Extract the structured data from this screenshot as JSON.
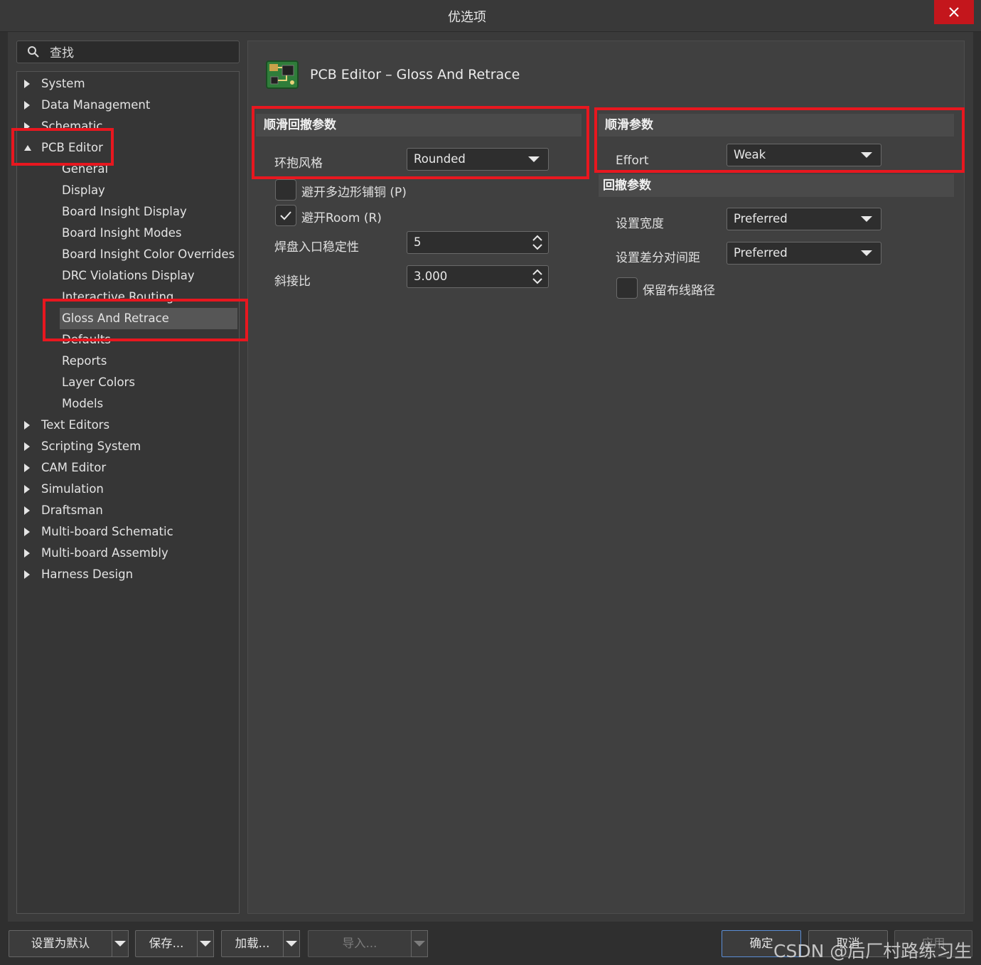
{
  "window": {
    "title": "优选项",
    "close_icon": "close-icon"
  },
  "search": {
    "placeholder": "查找"
  },
  "tree": {
    "items": [
      {
        "label": "System",
        "level": 1,
        "expanded": false
      },
      {
        "label": "Data Management",
        "level": 1,
        "expanded": false
      },
      {
        "label": "Schematic",
        "level": 1,
        "expanded": false
      },
      {
        "label": "PCB Editor",
        "level": 1,
        "expanded": true
      },
      {
        "label": "General",
        "level": 2
      },
      {
        "label": "Display",
        "level": 2
      },
      {
        "label": "Board Insight Display",
        "level": 2
      },
      {
        "label": "Board Insight Modes",
        "level": 2
      },
      {
        "label": "Board Insight Color Overrides",
        "level": 2
      },
      {
        "label": "DRC Violations Display",
        "level": 2
      },
      {
        "label": "Interactive Routing",
        "level": 2
      },
      {
        "label": "Gloss And Retrace",
        "level": 2,
        "selected": true
      },
      {
        "label": "Defaults",
        "level": 2
      },
      {
        "label": "Reports",
        "level": 2
      },
      {
        "label": "Layer Colors",
        "level": 2
      },
      {
        "label": "Models",
        "level": 2
      },
      {
        "label": "Text Editors",
        "level": 1,
        "expanded": false
      },
      {
        "label": "Scripting System",
        "level": 1,
        "expanded": false
      },
      {
        "label": "CAM Editor",
        "level": 1,
        "expanded": false
      },
      {
        "label": "Simulation",
        "level": 1,
        "expanded": false
      },
      {
        "label": "Draftsman",
        "level": 1,
        "expanded": false
      },
      {
        "label": "Multi-board Schematic",
        "level": 1,
        "expanded": false
      },
      {
        "label": "Multi-board Assembly",
        "level": 1,
        "expanded": false
      },
      {
        "label": "Harness Design",
        "level": 1,
        "expanded": false
      }
    ]
  },
  "page": {
    "title": "PCB Editor – Gloss And Retrace",
    "icon": "pcb-board-icon"
  },
  "gloss_retrace_params": {
    "header": "顺滑回撤参数",
    "hug_style_label": "环抱风格",
    "hug_style_value": "Rounded",
    "avoid_polygon_label": "避开多边形铺铜 (P)",
    "avoid_polygon_checked": false,
    "avoid_room_label": "避开Room (R)",
    "avoid_room_checked": true,
    "pad_entry_label": "焊盘入口稳定性",
    "pad_entry_value": "5",
    "miter_ratio_label": "斜接比",
    "miter_ratio_value": "3.000"
  },
  "gloss_params": {
    "header": "顺滑参数",
    "effort_label": "Effort",
    "effort_value": "Weak"
  },
  "retrace_params": {
    "header": "回撤参数",
    "width_label": "设置宽度",
    "width_value": "Preferred",
    "diff_gap_label": "设置差分对间距",
    "diff_gap_value": "Preferred",
    "keep_path_label": "保留布线路径",
    "keep_path_checked": false
  },
  "footer": {
    "set_default": "设置为默认",
    "save": "保存...",
    "load": "加载...",
    "import": "导入...",
    "ok": "确定",
    "cancel": "取消",
    "apply": "应用"
  },
  "watermark": "CSDN @后厂村路练习生",
  "colors": {
    "highlight": "#e8171f",
    "close": "#c4161c",
    "selected": "#565656"
  }
}
